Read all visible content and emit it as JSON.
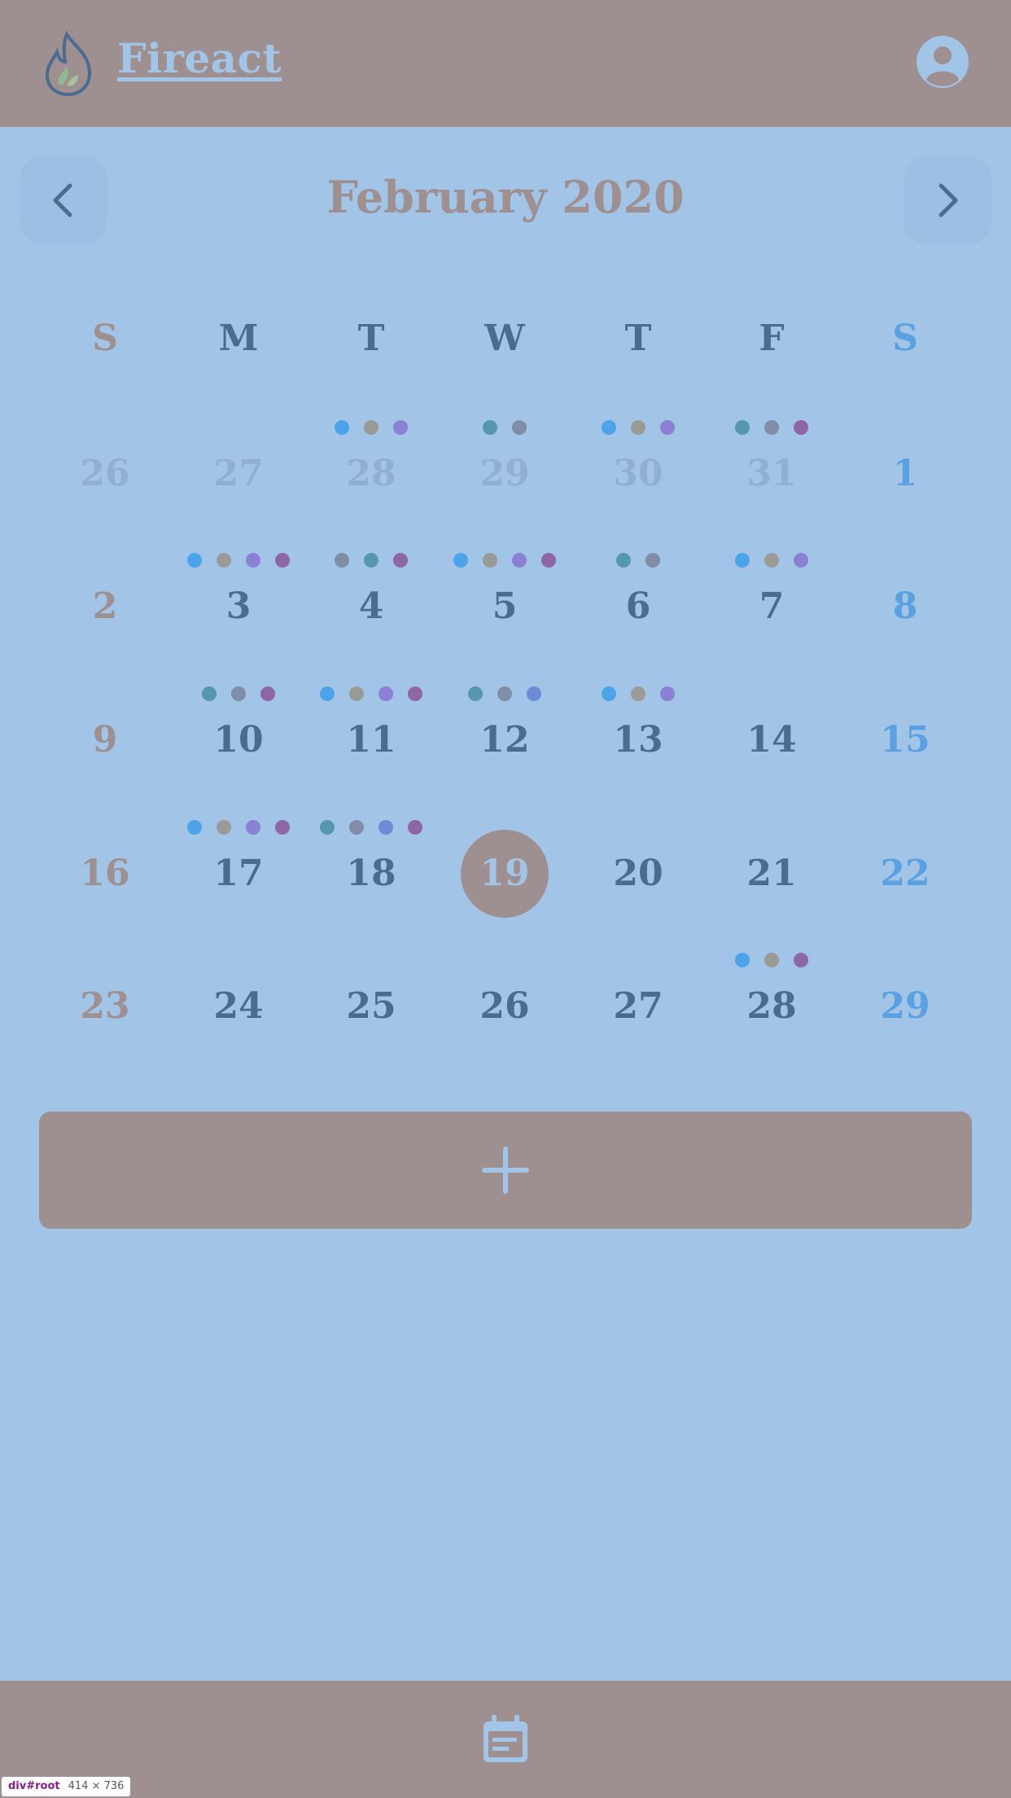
{
  "header": {
    "app_title": "Fireact",
    "logo_icon": "flame-icon",
    "avatar_icon": "user-avatar-icon"
  },
  "calendar": {
    "month_title": "February 2020",
    "prev_icon": "chevron-left-icon",
    "next_icon": "chevron-right-icon",
    "weekdays": [
      "S",
      "M",
      "T",
      "W",
      "T",
      "F",
      "S"
    ],
    "weeks": [
      [
        {
          "day": "26",
          "muted": true,
          "dots": []
        },
        {
          "day": "27",
          "muted": true,
          "dots": []
        },
        {
          "day": "28",
          "muted": true,
          "dots": [
            "#4da3e8",
            "#9a9a96",
            "#8b80d4"
          ]
        },
        {
          "day": "29",
          "muted": true,
          "dots": [
            "#5698ab",
            "#7f8da6"
          ]
        },
        {
          "day": "30",
          "muted": true,
          "dots": [
            "#4da3e8",
            "#9a9a96",
            "#8b80d4"
          ]
        },
        {
          "day": "31",
          "muted": true,
          "dots": [
            "#5698ab",
            "#7f8da6",
            "#8d66a6"
          ]
        },
        {
          "day": "1",
          "dots": []
        }
      ],
      [
        {
          "day": "2",
          "dots": []
        },
        {
          "day": "3",
          "dots": [
            "#4da3e8",
            "#9a9a96",
            "#8b80d4",
            "#8d66a6"
          ]
        },
        {
          "day": "4",
          "dots": [
            "#7f8da6",
            "#5698ab",
            "#8d66a6"
          ]
        },
        {
          "day": "5",
          "dots": [
            "#4da3e8",
            "#9a9a96",
            "#8b80d4",
            "#8d66a6"
          ]
        },
        {
          "day": "6",
          "dots": [
            "#5698ab",
            "#7f8da6"
          ]
        },
        {
          "day": "7",
          "dots": [
            "#4da3e8",
            "#9a9a96",
            "#8b80d4"
          ]
        },
        {
          "day": "8",
          "dots": []
        }
      ],
      [
        {
          "day": "9",
          "dots": []
        },
        {
          "day": "10",
          "dots": [
            "#5698ab",
            "#7f8da6",
            "#8d66a6"
          ]
        },
        {
          "day": "11",
          "dots": [
            "#4da3e8",
            "#9a9a96",
            "#8b80d4",
            "#8d66a6"
          ]
        },
        {
          "day": "12",
          "dots": [
            "#5698ab",
            "#7f8da6",
            "#6b8bd6"
          ]
        },
        {
          "day": "13",
          "dots": [
            "#4da3e8",
            "#9a9a96",
            "#8b80d4"
          ]
        },
        {
          "day": "14",
          "dots": []
        },
        {
          "day": "15",
          "dots": []
        }
      ],
      [
        {
          "day": "16",
          "dots": []
        },
        {
          "day": "17",
          "dots": [
            "#4da3e8",
            "#9a9a96",
            "#8b80d4",
            "#8d66a6"
          ]
        },
        {
          "day": "18",
          "dots": [
            "#5698ab",
            "#7f8da6",
            "#6b8bd6",
            "#8d66a6"
          ]
        },
        {
          "day": "19",
          "today": true,
          "dots": []
        },
        {
          "day": "20",
          "dots": []
        },
        {
          "day": "21",
          "dots": []
        },
        {
          "day": "22",
          "dots": []
        }
      ],
      [
        {
          "day": "23",
          "dots": []
        },
        {
          "day": "24",
          "dots": []
        },
        {
          "day": "25",
          "dots": []
        },
        {
          "day": "26",
          "dots": []
        },
        {
          "day": "27",
          "dots": []
        },
        {
          "day": "28",
          "dots": [
            "#4da3e8",
            "#9a9a96",
            "#8d66a6"
          ]
        },
        {
          "day": "29",
          "dots": []
        }
      ]
    ]
  },
  "add_button": {
    "icon": "plus-icon"
  },
  "footer": {
    "icon": "calendar-icon"
  },
  "dev_badge": {
    "tag": "div#root",
    "size": "414 × 736"
  },
  "colors": {
    "background": "#a2c4e7",
    "bar": "#9e8f91",
    "text": "#4a6c8e",
    "muted": "#8fb0d3",
    "saturday": "#5ba0e0"
  }
}
